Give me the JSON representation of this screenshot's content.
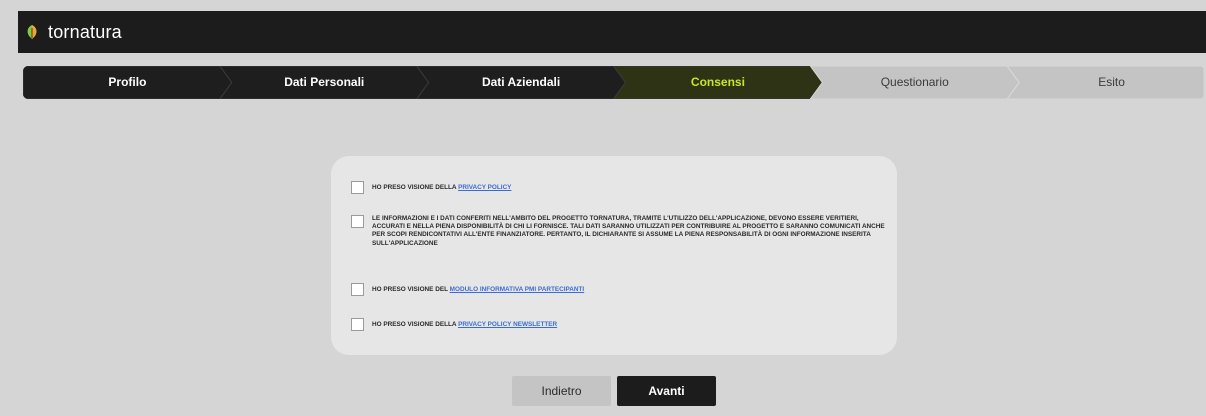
{
  "app": {
    "logo_text": "tornatura"
  },
  "steps": [
    {
      "label": "Profilo",
      "state": "done"
    },
    {
      "label": "Dati Personali",
      "state": "done"
    },
    {
      "label": "Dati Aziendali",
      "state": "done"
    },
    {
      "label": "Consensi",
      "state": "active"
    },
    {
      "label": "Questionario",
      "state": "pending"
    },
    {
      "label": "Esito",
      "state": "pending"
    }
  ],
  "consents": [
    {
      "prefix": "HO PRESO VISIONE DELLA ",
      "link": "PRIVACY POLICY",
      "checked": false
    },
    {
      "text": "LE INFORMAZIONI E I DATI CONFERITI NELL'AMBITO DEL PROGETTO TORNATURA, TRAMITE L'UTILIZZO DELL'APPLICAZIONE, DEVONO ESSERE VERITIERI, ACCURATI E NELLA PIENA DISPONIBILITÀ DI CHI LI FORNISCE. TALI DATI SARANNO UTILIZZATI PER CONTRIBUIRE AL PROGETTO E SARANNO COMUNICATI ANCHE PER SCOPI RENDICONTATIVI ALL'ENTE FINANZIATORE. PERTANTO, IL DICHIARANTE SI ASSUME LA PIENA RESPONSABILITÀ DI OGNI INFORMAZIONE INSERITA SULL'APPLICAZIONE",
      "checked": false
    },
    {
      "prefix": "HO PRESO VISIONE DEL ",
      "link": "MODULO INFORMATIVA PMI PARTECIPANTI",
      "checked": false
    },
    {
      "prefix": "HO PRESO VISIONE DELLA ",
      "link": "PRIVACY POLICY NEWSLETTER",
      "checked": false
    }
  ],
  "buttons": {
    "back": "Indietro",
    "next": "Avanti"
  },
  "colors": {
    "topbar": "#1c1c1c",
    "step_done": "#1e1e1e",
    "step_active": "#2d3314",
    "step_active_text": "#c6e629",
    "step_pending": "#c4c4c4",
    "link": "#3b6cd6",
    "logo_leaf": "#8cc63f"
  }
}
